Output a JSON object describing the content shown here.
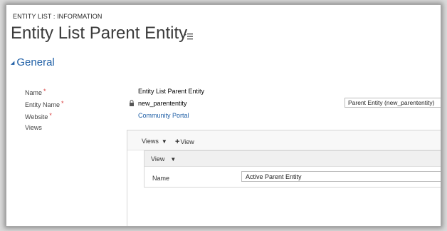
{
  "header": {
    "breadcrumb": "ENTITY LIST : INFORMATION",
    "title": "Entity List Parent Entity"
  },
  "section": {
    "title": "General"
  },
  "fields": {
    "name_label": "Name",
    "name_value": "Entity List Parent Entity",
    "entity_name_label": "Entity Name",
    "entity_name_value": "new_parententity",
    "entity_select_value": "Parent Entity (new_parententity)",
    "website_label": "Website",
    "website_value": "Community Portal",
    "views_label": "Views",
    "required_marker": "*"
  },
  "subgrid": {
    "views_label": "Views",
    "add_view_label": "View",
    "add_icon": "+",
    "inner_view_label": "View",
    "inner_name_label": "Name",
    "inner_name_value": "Active Parent Entity"
  },
  "colors": {
    "accent": "#1f5fa6",
    "required": "#d83b3b"
  }
}
